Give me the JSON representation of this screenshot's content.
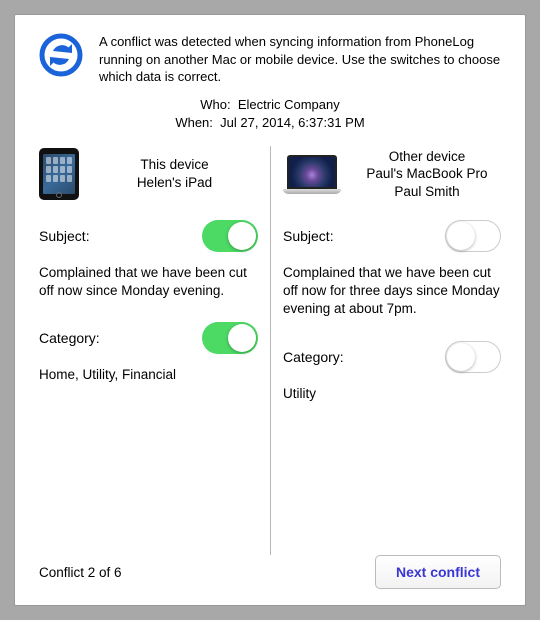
{
  "intro": "A conflict was detected when syncing information from PhoneLog running on another Mac or mobile device. Use the switches to choose which data is correct.",
  "meta": {
    "who_label": "Who:",
    "who_value": "Electric Company",
    "when_label": "When:",
    "when_value": "Jul 27, 2014, 6:37:31 PM"
  },
  "left": {
    "device_title": "This device",
    "device_name": "Helen's iPad",
    "subject_label": "Subject:",
    "subject_value": "Complained that we have been cut off now since Monday evening.",
    "subject_toggle": true,
    "category_label": "Category:",
    "category_value": "Home, Utility, Financial",
    "category_toggle": true
  },
  "right": {
    "device_title": "Other device",
    "device_name": "Paul's MacBook Pro",
    "device_user": "Paul Smith",
    "subject_label": "Subject:",
    "subject_value": "Complained that we have been cut off now for three days since Monday evening at about 7pm.",
    "subject_toggle": false,
    "category_label": "Category:",
    "category_value": "Utility",
    "category_toggle": false
  },
  "footer": {
    "counter": "Conflict 2 of 6",
    "next_label": "Next conflict"
  }
}
